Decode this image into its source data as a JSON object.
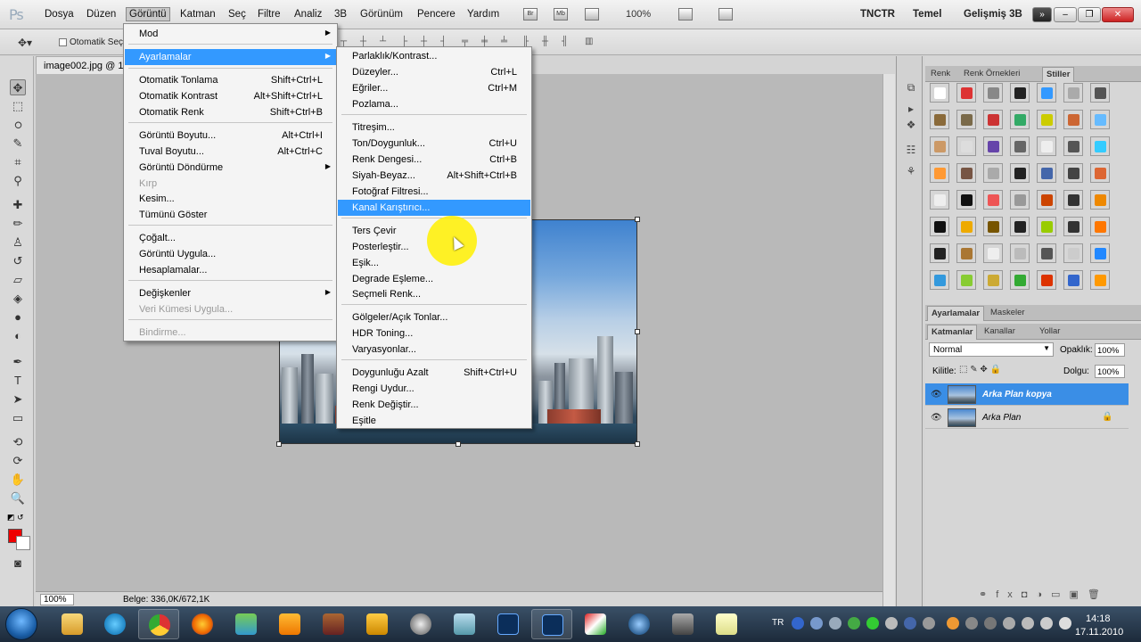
{
  "app": {
    "logo": "Ps"
  },
  "menubar": {
    "items": [
      "Dosya",
      "Düzen",
      "Görüntü",
      "Katman",
      "Seç",
      "Filtre",
      "Analiz",
      "3B",
      "Görünüm",
      "Pencere",
      "Yardım"
    ],
    "active": "Görüntü",
    "zoom": "100%",
    "workspaces": [
      "TNCTR",
      "Temel",
      "Gelişmiş 3B"
    ],
    "bridge_icon": "Br",
    "minibridge_icon": "Mb"
  },
  "options_bar": {
    "auto_select_label": "Otomatik Seç:"
  },
  "document": {
    "tab_title": "image002.jpg @ 1(",
    "zoom": "100%",
    "size_info": "Belge: 336,0K/672,1K"
  },
  "menu_goruntu": {
    "items": [
      {
        "label": "Mod",
        "shortcut": "",
        "submenu": true,
        "disabled": false
      },
      {
        "label": "Ayarlamalar",
        "shortcut": "",
        "submenu": true,
        "disabled": false,
        "highlighted": true
      },
      {
        "label": "Otomatik Tonlama",
        "shortcut": "Shift+Ctrl+L"
      },
      {
        "label": "Otomatik Kontrast",
        "shortcut": "Alt+Shift+Ctrl+L"
      },
      {
        "label": "Otomatik Renk",
        "shortcut": "Shift+Ctrl+B"
      },
      {
        "label": "Görüntü Boyutu...",
        "shortcut": "Alt+Ctrl+I"
      },
      {
        "label": "Tuval Boyutu...",
        "shortcut": "Alt+Ctrl+C"
      },
      {
        "label": "Görüntü Döndürme",
        "shortcut": "",
        "submenu": true
      },
      {
        "label": "Kırp",
        "shortcut": "",
        "disabled": true
      },
      {
        "label": "Kesim...",
        "shortcut": ""
      },
      {
        "label": "Tümünü Göster",
        "shortcut": ""
      },
      {
        "label": "Çoğalt...",
        "shortcut": ""
      },
      {
        "label": "Görüntü Uygula...",
        "shortcut": ""
      },
      {
        "label": "Hesaplamalar...",
        "shortcut": ""
      },
      {
        "label": "Değişkenler",
        "shortcut": "",
        "submenu": true
      },
      {
        "label": "Veri Kümesi Uygula...",
        "shortcut": "",
        "disabled": true
      },
      {
        "label": "Bindirme...",
        "shortcut": "",
        "disabled": true
      }
    ]
  },
  "menu_ayarlamalar": {
    "items": [
      {
        "label": "Parlaklık/Kontrast...",
        "shortcut": ""
      },
      {
        "label": "Düzeyler...",
        "shortcut": "Ctrl+L"
      },
      {
        "label": "Eğriler...",
        "shortcut": "Ctrl+M"
      },
      {
        "label": "Pozlama...",
        "shortcut": ""
      },
      {
        "label": "Titreşim...",
        "shortcut": ""
      },
      {
        "label": "Ton/Doygunluk...",
        "shortcut": "Ctrl+U"
      },
      {
        "label": "Renk Dengesi...",
        "shortcut": "Ctrl+B"
      },
      {
        "label": "Siyah-Beyaz...",
        "shortcut": "Alt+Shift+Ctrl+B"
      },
      {
        "label": "Fotoğraf Filtresi...",
        "shortcut": ""
      },
      {
        "label": "Kanal Karıştırıcı...",
        "shortcut": "",
        "highlighted": true
      },
      {
        "label": "Ters Çevir",
        "shortcut": ""
      },
      {
        "label": "Posterleştir...",
        "shortcut": ""
      },
      {
        "label": "Eşik...",
        "shortcut": ""
      },
      {
        "label": "Degrade Eşleme...",
        "shortcut": ""
      },
      {
        "label": "Seçmeli Renk...",
        "shortcut": ""
      },
      {
        "label": "Gölgeler/Açık Tonlar...",
        "shortcut": ""
      },
      {
        "label": "HDR Toning...",
        "shortcut": ""
      },
      {
        "label": "Varyasyonlar...",
        "shortcut": ""
      },
      {
        "label": "Doygunluğu Azalt",
        "shortcut": "Shift+Ctrl+U"
      },
      {
        "label": "Rengi Uydur...",
        "shortcut": ""
      },
      {
        "label": "Renk Değiştir...",
        "shortcut": ""
      },
      {
        "label": "Eşitle",
        "shortcut": ""
      }
    ]
  },
  "panels": {
    "top_tabs": [
      "Renk",
      "Renk Örnekleri",
      "Stiller"
    ],
    "mid_tabs": [
      "Ayarlamalar",
      "Maskeler"
    ],
    "layer_tabs": [
      "Katmanlar",
      "Kanallar",
      "Yollar"
    ],
    "blend_mode": "Normal",
    "opacity_label": "Opaklık:",
    "opacity_value": "100%",
    "lock_label": "Kilitle:",
    "fill_label": "Dolgu:",
    "fill_value": "100%",
    "layers": [
      {
        "name": "Arka Plan kopya",
        "selected": true
      },
      {
        "name": "Arka Plan",
        "selected": false
      }
    ]
  },
  "taskbar": {
    "lang": "TR",
    "time": "14:18",
    "date": "17.11.2010"
  },
  "colors": {
    "accent": "#3399ff",
    "foreground": "#ee0000",
    "cursor_highlight": "#fff000"
  }
}
